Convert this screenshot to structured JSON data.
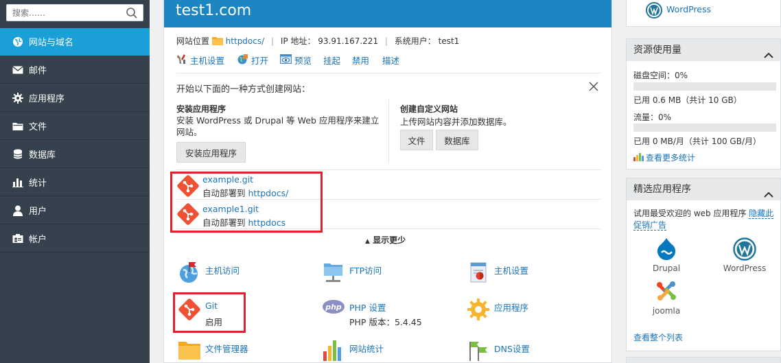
{
  "search": {
    "placeholder": "搜索……"
  },
  "sidebar": {
    "items": [
      {
        "label": "网站与域名",
        "icon": "globe-icon",
        "active": true
      },
      {
        "label": "邮件",
        "icon": "envelope-icon"
      },
      {
        "label": "应用程序",
        "icon": "gear-icon"
      },
      {
        "label": "文件",
        "icon": "folder-icon"
      },
      {
        "label": "数据库",
        "icon": "database-icon"
      },
      {
        "label": "统计",
        "icon": "bar-chart-icon"
      },
      {
        "label": "用户",
        "icon": "user-icon"
      },
      {
        "label": "帐户",
        "icon": "id-card-icon"
      }
    ]
  },
  "site": {
    "domain": "test1.com",
    "location_label": "网站位置",
    "location_link": "httpdocs/",
    "ip_label": "IP 地址：",
    "ip": "93.91.167.221",
    "sysuser_label": "系统用户：",
    "sysuser": "test1"
  },
  "toolbar": {
    "host_settings": "主机设置",
    "open": "打开",
    "preview": "预览",
    "suspend": "挂起",
    "disable": "禁用",
    "describe": "描述"
  },
  "create": {
    "heading": "开始以下面的一种方式创建网站：",
    "install_title": "安装应用程序",
    "install_desc": "安装 WordPress 或 Drupal 等 Web 应用程序来建立网站。",
    "install_button": "安装应用程序",
    "custom_title": "创建自定义网站",
    "custom_desc": "上传网站内容并添加数据库。",
    "files_button": "文件",
    "db_button": "数据库"
  },
  "git_repos": [
    {
      "name": "example.git",
      "deploy_prefix": "自动部署到",
      "deploy_target": "httpdocs/"
    },
    {
      "name": "example1.git",
      "deploy_prefix": "自动部署到",
      "deploy_target": "httpdocs"
    }
  ],
  "show_less": "显示更少",
  "tools": {
    "host_access": "主机访问",
    "ftp_access": "FTP访问",
    "host_settings": "主机设置",
    "git": "Git",
    "git_status": "启用",
    "php_settings": "PHP 设置",
    "php_version": "PHP 版本：5.4.45",
    "applications": "应用程序",
    "file_manager": "文件管理器",
    "site_stats": "网站统计",
    "dns_settings": "DNS设置"
  },
  "right": {
    "wordpress_link": "WordPress",
    "resource": {
      "title": "资源使用量",
      "disk_label": "磁盘空间：0%",
      "disk_percent": 0,
      "disk_used": "已用 0.6 MB（共计 10 GB）",
      "traffic_label": "流量：0%",
      "traffic_percent": 0,
      "traffic_used": "已用 0 MB/月（共计 100 GB/月）",
      "more_stats": "查看更多统计"
    },
    "featured": {
      "title": "精选应用程序",
      "intro": "试用最受欢迎的 web 应用程序",
      "hide_ad": "隐藏此促销广告",
      "apps": [
        "Drupal",
        "WordPress",
        "joomla"
      ],
      "view_all": "查看整个列表"
    }
  },
  "colors": {
    "accent": "#1d86c2",
    "sidebar": "#35414c",
    "active": "#1a9fd8",
    "git": "#f05133",
    "highlight": "#e0202a"
  }
}
